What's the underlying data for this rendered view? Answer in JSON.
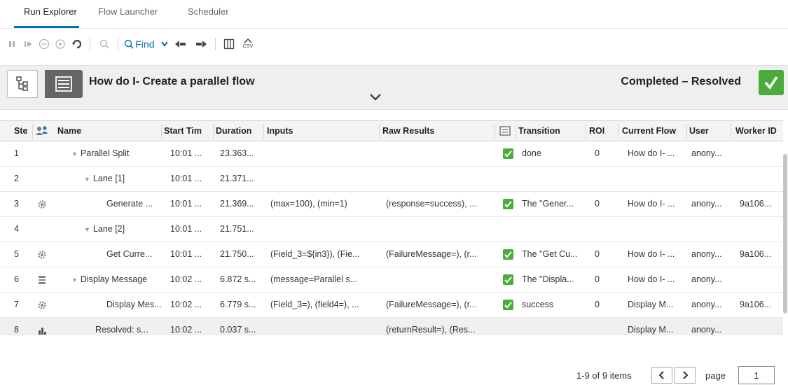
{
  "tabs": [
    {
      "label": "Run Explorer",
      "active": true
    },
    {
      "label": "Flow Launcher",
      "active": false
    },
    {
      "label": "Scheduler",
      "active": false
    }
  ],
  "toolbar": {
    "buttons": [
      "pause-icon",
      "resume-icon",
      "cancel-icon",
      "reassign-icon",
      "refresh-icon",
      "inspect-icon",
      "find-icon",
      "prev-icon",
      "next-icon",
      "columns-icon",
      "export-csv-icon"
    ],
    "find_label": "Find",
    "csv_label": "CSV"
  },
  "header": {
    "flow_title": "How do I- Create a parallel flow",
    "status": "Completed – Resolved",
    "status_color": "#4cab3a"
  },
  "table": {
    "columns": [
      "Ste",
      "",
      "Name",
      "Start Tim",
      "Duration",
      "Inputs",
      "Raw Results",
      "",
      "Transition",
      "ROI",
      "Current Flow",
      "User",
      "Worker ID"
    ],
    "rows": [
      {
        "step": "1",
        "icon": "",
        "expander": true,
        "name": "Parallel Split",
        "start": "10:01 ...",
        "duration": "23.363...",
        "inputs": "",
        "raw": "",
        "check": true,
        "transition": "done",
        "roi": "0",
        "flow": "How do I- ...",
        "user": "anony...",
        "worker": ""
      },
      {
        "step": "2",
        "icon": "",
        "expander": true,
        "name": "Lane [1]",
        "start": "10:01 ...",
        "duration": "21.371...",
        "inputs": "",
        "raw": "",
        "check": false,
        "transition": "",
        "roi": "",
        "flow": "",
        "user": "",
        "worker": ""
      },
      {
        "step": "3",
        "icon": "gear-icon",
        "expander": false,
        "name": "Generate ...",
        "start": "10:01 ...",
        "duration": "21.369...",
        "inputs": "(max=100), (min=1)",
        "raw": "(response=success), ...",
        "check": true,
        "transition": "The \"Gener...",
        "roi": "0",
        "flow": "How do I- ...",
        "user": "anony...",
        "worker": "9a106..."
      },
      {
        "step": "4",
        "icon": "",
        "expander": true,
        "name": "Lane [2]",
        "start": "10:01 ...",
        "duration": "21.751...",
        "inputs": "",
        "raw": "",
        "check": false,
        "transition": "",
        "roi": "",
        "flow": "",
        "user": "",
        "worker": ""
      },
      {
        "step": "5",
        "icon": "gear-icon",
        "expander": false,
        "name": "Get Curre...",
        "start": "10:01 ...",
        "duration": "21.750...",
        "inputs": "(Field_3=${in3}), (Fie...",
        "raw": "(FailureMessage=), (r...",
        "check": true,
        "transition": "The \"Get Cu...",
        "roi": "0",
        "flow": "How do I- ...",
        "user": "anony...",
        "worker": "9a106..."
      },
      {
        "step": "6",
        "icon": "subflow-icon",
        "expander": true,
        "name": "Display Message",
        "start": "10:02 ...",
        "duration": "6.872 s...",
        "inputs": "(message=Parallel s...",
        "raw": "",
        "check": true,
        "transition": "The \"Displa...",
        "roi": "0",
        "flow": "How do I- ...",
        "user": "anony...",
        "worker": ""
      },
      {
        "step": "7",
        "icon": "gear-icon",
        "expander": false,
        "name": "Display Mes...",
        "start": "10:02 ...",
        "duration": "6.779 s...",
        "inputs": "(Field_3=), (field4=), ...",
        "raw": "(FailureMessage=), (r...",
        "check": true,
        "transition": "success",
        "roi": "0",
        "flow": "Display M...",
        "user": "anony...",
        "worker": "9a106..."
      },
      {
        "step": "8",
        "icon": "resolved-icon",
        "expander": false,
        "name": "Resolved: s...",
        "start": "10:02 ...",
        "duration": "0.037 s...",
        "inputs": "",
        "raw": "(returnResult=), (Res...",
        "check": false,
        "transition": "",
        "roi": "",
        "flow": "Display M...",
        "user": "anony...",
        "worker": ""
      }
    ]
  },
  "pager": {
    "info": "1-9 of 9 items",
    "page_label": "page",
    "page_value": "1"
  }
}
